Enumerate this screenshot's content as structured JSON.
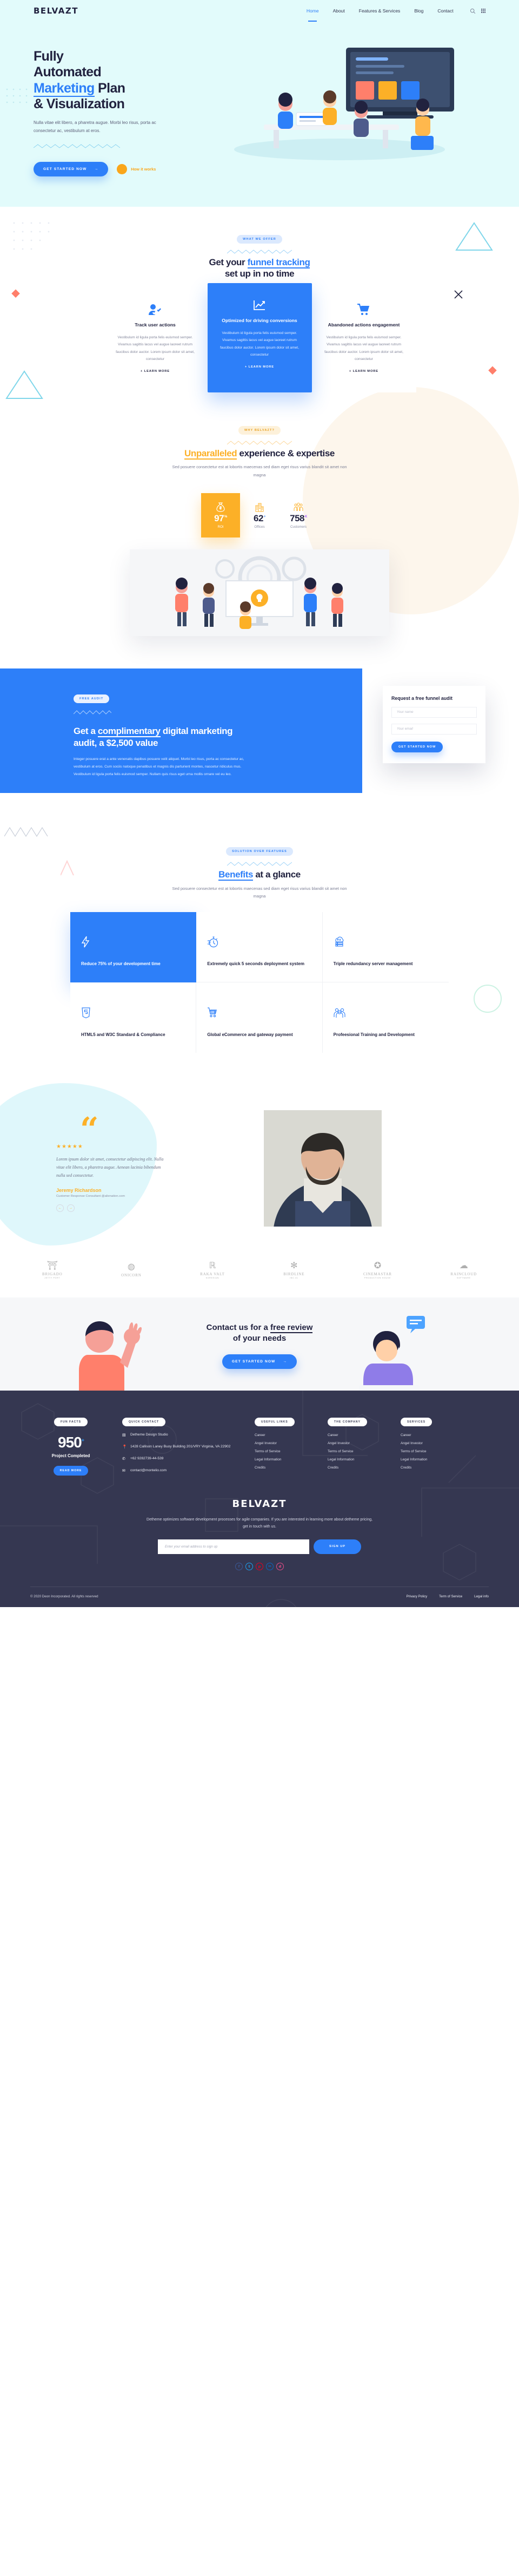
{
  "header": {
    "logo": "BELVAZT",
    "nav": [
      {
        "label": "Home",
        "active": true
      },
      {
        "label": "About",
        "active": false
      },
      {
        "label": "Features & Services",
        "active": false
      },
      {
        "label": "Blog",
        "active": false
      },
      {
        "label": "Contact",
        "active": false
      }
    ],
    "search_icon": "search-icon",
    "grid_icon": "grid-menu-icon"
  },
  "hero": {
    "title_line1": "Fully",
    "title_line2": "Automated",
    "title_accent": "Marketing",
    "title_line3_rest": " Plan",
    "title_line4": "& Visualization",
    "subtitle": "Nulla vitae elit libero, a pharetra augue. Morbi leo risus, porta ac consectetur ac, vestibulum at eros.",
    "cta_label": "GET STARTED NOW",
    "cta_arrow": "→",
    "video_label": "How it works",
    "play_icon": "play-icon"
  },
  "offer": {
    "pill": "WHAT WE OFFER",
    "title_plain": "Get your ",
    "title_accent": "funnel tracking",
    "title_line2": "set up in no time",
    "cards": [
      {
        "icon": "user-check-icon",
        "title": "Track user actions",
        "body": "Vestibulum id ligula porta felis euismod semper. Vivamus sagittis lacus vel augue laoreet rutrum faucibus dolor auctor. Lorem ipsum dolor sit amet, consectetur",
        "link": "+ LEARN MORE"
      },
      {
        "icon": "chart-line-icon",
        "title": "Optimized for driving conversions",
        "body": "Vestibulum id ligula porta felis euismod semper. Vivamus sagittis lacus vel augue laoreet rutrum faucibus dolor auctor. Lorem ipsum dolor sit amet, consectetur",
        "link": "+ LEARN MORE"
      },
      {
        "icon": "shopping-cart-icon",
        "title": "Abandoned actions engagement",
        "body": "Vestibulum id ligula porta felis euismod semper. Vivamus sagittis lacus vel augue laoreet rutrum faucibus dolor auctor. Lorem ipsum dolor sit amet, consectetur",
        "link": "+ LEARN MORE"
      }
    ]
  },
  "why": {
    "pill": "WHY BELVAZT?",
    "title_accent": "Unparalleled",
    "title_rest": " experience & expertise",
    "subtitle": "Sed posuere consectetur est at lobortis maecenas sed diam eget risus varius blandit sit amet non magna",
    "stats": [
      {
        "icon": "money-bag-icon",
        "value": "97",
        "suffix": "%",
        "label": "ROI"
      },
      {
        "icon": "buildings-icon",
        "value": "62",
        "suffix": "+",
        "label": "Offices"
      },
      {
        "icon": "people-group-icon",
        "value": "758",
        "suffix": "K",
        "label": "Customers"
      }
    ]
  },
  "audit": {
    "pill": "FREE AUDIT",
    "title_a": "Get a ",
    "title_u": "complimentary",
    "title_b": " digital marketing audit, a $2,500 value",
    "body": "Integer posuere erat a ante venenatis dapibus posuere velit aliquet. Morbi leo risus, porta ac consectetur ac, vestibulum at eros. Cum sociis natoque penatibus et magnis dis parturient montes, nascetur ridiculus mus. Vestibulum id ligula porta felis euismod semper. Nullam quis risus eget urna mollis ornare vel eu leo.",
    "form": {
      "title": "Request a free funnel audit",
      "name_placeholder": "Your name",
      "email_placeholder": "Your email",
      "submit_label": "GET STARTED NOW"
    }
  },
  "benefits": {
    "pill": "SOLUTION OVER FEATURES",
    "title_accent": "Benefits",
    "title_rest": " at a glance",
    "subtitle": "Sed posuere consectetur est at lobortis maecenas sed diam eget risus varius blandit sit amet non magna",
    "items": [
      {
        "icon": "lightning-bolt-icon",
        "title": "Reduce 75% of your development time",
        "highlight": true
      },
      {
        "icon": "stopwatch-icon",
        "title": "Extremely quick 5 seconds deployment system",
        "highlight": false
      },
      {
        "icon": "cloud-server-icon",
        "title": "Triple redundancy server management",
        "highlight": false
      },
      {
        "icon": "html5-shield-icon",
        "title": "HTML5 and W3C Standard & Compliance",
        "highlight": false
      },
      {
        "icon": "shopping-cart-icon",
        "title": "Global eCommerce and gateway payment",
        "highlight": false
      },
      {
        "icon": "team-icon",
        "title": "Profeesional Training and Development",
        "highlight": false
      }
    ]
  },
  "testimonial": {
    "stars": "★★★★★",
    "quote_mark": "“",
    "quote": "Lorem ipsum dolor sit amet, consectetur adipiscing elit. Nulla vitae elit libero, a pharetra augue. Aenean lacinia bibendum nulla sed consectetur.",
    "author": "Jeremy Richardson",
    "role": "Customer Response Consultant @alienation.com",
    "prev_icon": "arrow-left-icon",
    "next_icon": "arrow-right-icon"
  },
  "clients": [
    {
      "mark": "⛩",
      "name": "BRIGADO",
      "sub": "JETTY PORT"
    },
    {
      "mark": "◍",
      "name": "ONICORN",
      "sub": ""
    },
    {
      "mark": "ℝ",
      "name": "RAKA VALT",
      "sub": "KORESIAN"
    },
    {
      "mark": "✻",
      "name": "BIRDLINE",
      "sub": "INC.41"
    },
    {
      "mark": "✪",
      "name": "CINEMASTAR",
      "sub": "PRODUCTION HOUSE"
    },
    {
      "mark": "☁",
      "name": "RAINCLOUD",
      "sub": "SOFTWARE"
    }
  ],
  "cta": {
    "title_a": "Contact us for a ",
    "title_u": "free review",
    "title_b": "of your needs",
    "button": "GET STARTED NOW",
    "arrow": "→"
  },
  "footer": {
    "fun_facts": {
      "pill": "FUN FACTS",
      "number": "950",
      "suffix": "+",
      "label": "Project Completed",
      "button": "READ MORE"
    },
    "quick_contact": {
      "pill": "QUICK CONTACT",
      "items": [
        {
          "icon": "building-icon",
          "text": "Detheme Design Studio"
        },
        {
          "icon": "location-pin-icon",
          "text": "1428 Callison Laney Buoy Building 201/VRY Virginia, VA 22902"
        },
        {
          "icon": "phone-icon",
          "text": "+62 9282739-44-539"
        },
        {
          "icon": "envelope-icon",
          "text": "contact@montelio.com"
        }
      ]
    },
    "columns": [
      {
        "pill": "USEFUL LINKS",
        "links": [
          "Career",
          "Angel Investor",
          "Terms of Service",
          "Legal Information",
          "Credits"
        ]
      },
      {
        "pill": "THE COMPANY",
        "links": [
          "Career",
          "Angel Investor",
          "Terms of Service",
          "Legal Information",
          "Credits"
        ]
      },
      {
        "pill": "SERVICES",
        "links": [
          "Career",
          "Angel Investor",
          "Terms of Service",
          "Legal Information",
          "Credits"
        ]
      }
    ],
    "brand": "BELVAZT",
    "description": "Detheme optimizes software development processes for agile companies. If you are interested in learning more about detheme pricing, get in touch with us.",
    "newsletter": {
      "placeholder": "Enter your email address to sign up",
      "button": "SIGN UP"
    },
    "socials": [
      {
        "name": "facebook-icon",
        "glyph": "f",
        "color": "#3b5998"
      },
      {
        "name": "twitter-icon",
        "glyph": "t",
        "color": "#1da1f2"
      },
      {
        "name": "pinterest-icon",
        "glyph": "p",
        "color": "#e60023"
      },
      {
        "name": "linkedin-icon",
        "glyph": "in",
        "color": "#0a66c2"
      },
      {
        "name": "dribbble-icon",
        "glyph": "d",
        "color": "#ea4c89"
      }
    ],
    "copyright": "© 2020 Deon Incorporated. All rights reserved",
    "bottom_links": [
      "Privacy Policy",
      "Term of Service",
      "Legal info"
    ]
  },
  "colors": {
    "brand_blue": "#2d7ff9",
    "amber": "#fcb027",
    "hero_bg": "#e2fbfb",
    "footer_bg": "#353751",
    "dark_text": "#21223f"
  }
}
